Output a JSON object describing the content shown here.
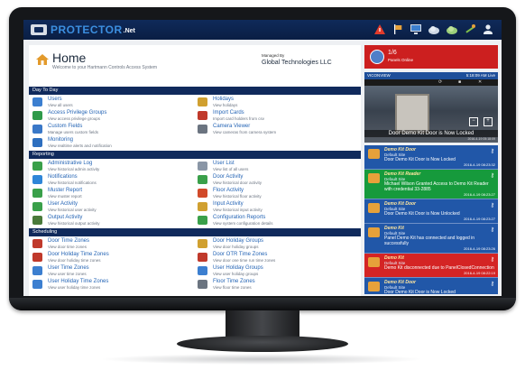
{
  "app": {
    "brand": "PROTECTOR",
    "brand_suffix": ".Net"
  },
  "home": {
    "title": "Home",
    "subtitle": "Welcome to your Hartmann Controls Access System",
    "managed_label": "Managed By",
    "company": "Global Technologies LLC"
  },
  "sections": [
    {
      "title": "Day To Day",
      "items": [
        {
          "label": "Users",
          "desc": "View all users",
          "icon": "users-icon",
          "color": "#3c7fd0"
        },
        {
          "label": "Holidays",
          "desc": "View holidays",
          "icon": "holidays-icon",
          "color": "#d0a030"
        },
        {
          "label": "Access Privilege Groups",
          "desc": "View access privilege groups",
          "icon": "access-groups-icon",
          "color": "#2f9a4a"
        },
        {
          "label": "Import Cards",
          "desc": "Import card holders from csv",
          "icon": "import-cards-icon",
          "color": "#c0392b"
        },
        {
          "label": "Custom Fields",
          "desc": "Manage users custom fields",
          "icon": "custom-fields-icon",
          "color": "#3a78c8"
        },
        {
          "label": "Camera Viewer",
          "desc": "View cameras from camera system",
          "icon": "camera-icon",
          "color": "#6b7480"
        },
        {
          "label": "Monitoring",
          "desc": "View realtime alerts and notification",
          "icon": "monitoring-icon",
          "color": "#2e6fbf"
        }
      ]
    },
    {
      "title": "Reporting",
      "items": [
        {
          "label": "Administrative Log",
          "desc": "View historical admin activity",
          "icon": "admin-log-icon",
          "color": "#3aa04a"
        },
        {
          "label": "User List",
          "desc": "View list of all users",
          "icon": "user-list-icon",
          "color": "#8a96a6"
        },
        {
          "label": "Notifications",
          "desc": "View historical notifications",
          "icon": "notifications-icon",
          "color": "#2f86d8"
        },
        {
          "label": "Door Activity",
          "desc": "View historical door activity",
          "icon": "door-activity-icon",
          "color": "#3aa04a"
        },
        {
          "label": "Muster Report",
          "desc": "View muster report",
          "icon": "muster-report-icon",
          "color": "#3aa04a"
        },
        {
          "label": "Floor Activity",
          "desc": "View historical floor activity",
          "icon": "floor-activity-icon",
          "color": "#d14a2a"
        },
        {
          "label": "User Activity",
          "desc": "View historical user activity",
          "icon": "user-activity-icon",
          "color": "#3aa04a"
        },
        {
          "label": "Input Activity",
          "desc": "View historical input activity",
          "icon": "input-activity-icon",
          "color": "#d0a030"
        },
        {
          "label": "Output Activity",
          "desc": "View historical output activity",
          "icon": "output-activity-icon",
          "color": "#4a7a3a"
        },
        {
          "label": "Configuration Reports",
          "desc": "View system configuration details",
          "icon": "config-reports-icon",
          "color": "#3aa04a"
        }
      ]
    },
    {
      "title": "Scheduling",
      "items": [
        {
          "label": "Door Time Zones",
          "desc": "View door time zones",
          "icon": "door-time-zones-icon",
          "color": "#c0392b"
        },
        {
          "label": "Door Holiday Groups",
          "desc": "View door holiday groups",
          "icon": "door-holiday-groups-icon",
          "color": "#d0a030"
        },
        {
          "label": "Door Holiday Time Zones",
          "desc": "View door holiday time zones",
          "icon": "door-holiday-tz-icon",
          "color": "#c0392b"
        },
        {
          "label": "Door OTR Time Zones",
          "desc": "View door one time run time zones",
          "icon": "door-otr-icon",
          "color": "#c0392b"
        },
        {
          "label": "User Time Zones",
          "desc": "View user time zones",
          "icon": "user-time-zones-icon",
          "color": "#3c7fd0"
        },
        {
          "label": "User Holiday Groups",
          "desc": "View user holiday groups",
          "icon": "user-holiday-groups-icon",
          "color": "#3c7fd0"
        },
        {
          "label": "User Holiday Time Zones",
          "desc": "View user holiday time zones",
          "icon": "user-holiday-tz-icon",
          "color": "#3c7fd0"
        },
        {
          "label": "Floor Time Zones",
          "desc": "View floor time zones",
          "icon": "floor-time-zones-icon",
          "color": "#6b7480"
        }
      ]
    }
  ],
  "alert": {
    "count": "1/6",
    "label": "Panels Online"
  },
  "camera": {
    "name": "VICONVIEW",
    "time": "5:18:09 AM Live",
    "caption": "Door Demo Kit Door is Now Locked",
    "date": "2016-4-19 05:18:09"
  },
  "events": [
    {
      "title": "Demo Kit Door",
      "site": "Default Site",
      "msg": "Door Demo Kit Door is Now Locked",
      "time": "2016-4-19 08:23:32",
      "color": "blue"
    },
    {
      "title": "Demo Kit Reader",
      "site": "Default Site",
      "msg": "Michael Wilson Granted Access to Demo Kit Reader with credential 33-2885",
      "time": "2016-4-19 08:23:27",
      "color": "green"
    },
    {
      "title": "Demo Kit Door",
      "site": "Default Site",
      "msg": "Door Demo Kit Door is Now Unlocked",
      "time": "2016-4-19 08:23:27",
      "color": "blue"
    },
    {
      "title": "Demo Kit",
      "site": "Default Site",
      "msg": "Panel Demo Kit has connected and logged in successfully",
      "time": "2016-4-19 08:23:26",
      "color": "blue"
    },
    {
      "title": "Demo Kit",
      "site": "Default Site",
      "msg": "Demo Kit disconnected due to PanelClosedConnection",
      "time": "2016-4-19 08:22:19",
      "color": "red"
    },
    {
      "title": "Demo Kit Door",
      "site": "Default Site",
      "msg": "Door Demo Kit Door is Now Locked",
      "time": "2016-4-19 08:22:08",
      "color": "blue"
    }
  ]
}
